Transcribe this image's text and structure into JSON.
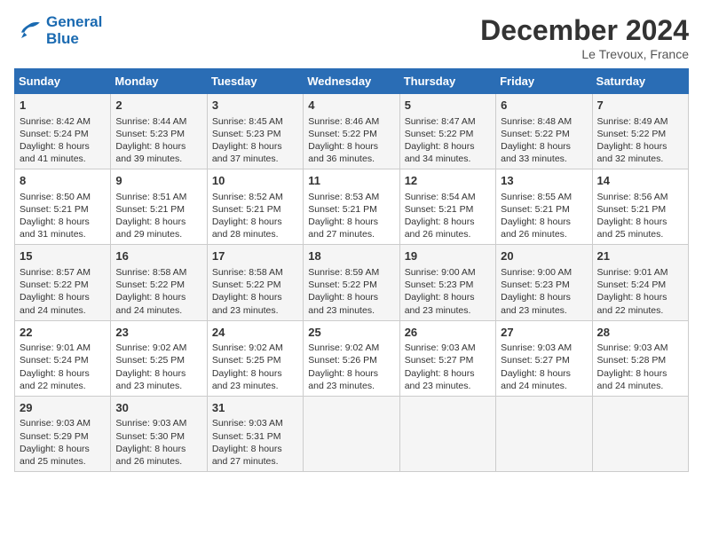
{
  "logo": {
    "line1": "General",
    "line2": "Blue"
  },
  "title": "December 2024",
  "location": "Le Trevoux, France",
  "days_of_week": [
    "Sunday",
    "Monday",
    "Tuesday",
    "Wednesday",
    "Thursday",
    "Friday",
    "Saturday"
  ],
  "weeks": [
    [
      {
        "num": "1",
        "sunrise": "8:42 AM",
        "sunset": "5:24 PM",
        "daylight": "8 hours and 41 minutes."
      },
      {
        "num": "2",
        "sunrise": "8:44 AM",
        "sunset": "5:23 PM",
        "daylight": "8 hours and 39 minutes."
      },
      {
        "num": "3",
        "sunrise": "8:45 AM",
        "sunset": "5:23 PM",
        "daylight": "8 hours and 37 minutes."
      },
      {
        "num": "4",
        "sunrise": "8:46 AM",
        "sunset": "5:22 PM",
        "daylight": "8 hours and 36 minutes."
      },
      {
        "num": "5",
        "sunrise": "8:47 AM",
        "sunset": "5:22 PM",
        "daylight": "8 hours and 34 minutes."
      },
      {
        "num": "6",
        "sunrise": "8:48 AM",
        "sunset": "5:22 PM",
        "daylight": "8 hours and 33 minutes."
      },
      {
        "num": "7",
        "sunrise": "8:49 AM",
        "sunset": "5:22 PM",
        "daylight": "8 hours and 32 minutes."
      }
    ],
    [
      {
        "num": "8",
        "sunrise": "8:50 AM",
        "sunset": "5:21 PM",
        "daylight": "8 hours and 31 minutes."
      },
      {
        "num": "9",
        "sunrise": "8:51 AM",
        "sunset": "5:21 PM",
        "daylight": "8 hours and 29 minutes."
      },
      {
        "num": "10",
        "sunrise": "8:52 AM",
        "sunset": "5:21 PM",
        "daylight": "8 hours and 28 minutes."
      },
      {
        "num": "11",
        "sunrise": "8:53 AM",
        "sunset": "5:21 PM",
        "daylight": "8 hours and 27 minutes."
      },
      {
        "num": "12",
        "sunrise": "8:54 AM",
        "sunset": "5:21 PM",
        "daylight": "8 hours and 26 minutes."
      },
      {
        "num": "13",
        "sunrise": "8:55 AM",
        "sunset": "5:21 PM",
        "daylight": "8 hours and 26 minutes."
      },
      {
        "num": "14",
        "sunrise": "8:56 AM",
        "sunset": "5:21 PM",
        "daylight": "8 hours and 25 minutes."
      }
    ],
    [
      {
        "num": "15",
        "sunrise": "8:57 AM",
        "sunset": "5:22 PM",
        "daylight": "8 hours and 24 minutes."
      },
      {
        "num": "16",
        "sunrise": "8:58 AM",
        "sunset": "5:22 PM",
        "daylight": "8 hours and 24 minutes."
      },
      {
        "num": "17",
        "sunrise": "8:58 AM",
        "sunset": "5:22 PM",
        "daylight": "8 hours and 23 minutes."
      },
      {
        "num": "18",
        "sunrise": "8:59 AM",
        "sunset": "5:22 PM",
        "daylight": "8 hours and 23 minutes."
      },
      {
        "num": "19",
        "sunrise": "9:00 AM",
        "sunset": "5:23 PM",
        "daylight": "8 hours and 23 minutes."
      },
      {
        "num": "20",
        "sunrise": "9:00 AM",
        "sunset": "5:23 PM",
        "daylight": "8 hours and 23 minutes."
      },
      {
        "num": "21",
        "sunrise": "9:01 AM",
        "sunset": "5:24 PM",
        "daylight": "8 hours and 22 minutes."
      }
    ],
    [
      {
        "num": "22",
        "sunrise": "9:01 AM",
        "sunset": "5:24 PM",
        "daylight": "8 hours and 22 minutes."
      },
      {
        "num": "23",
        "sunrise": "9:02 AM",
        "sunset": "5:25 PM",
        "daylight": "8 hours and 23 minutes."
      },
      {
        "num": "24",
        "sunrise": "9:02 AM",
        "sunset": "5:25 PM",
        "daylight": "8 hours and 23 minutes."
      },
      {
        "num": "25",
        "sunrise": "9:02 AM",
        "sunset": "5:26 PM",
        "daylight": "8 hours and 23 minutes."
      },
      {
        "num": "26",
        "sunrise": "9:03 AM",
        "sunset": "5:27 PM",
        "daylight": "8 hours and 23 minutes."
      },
      {
        "num": "27",
        "sunrise": "9:03 AM",
        "sunset": "5:27 PM",
        "daylight": "8 hours and 24 minutes."
      },
      {
        "num": "28",
        "sunrise": "9:03 AM",
        "sunset": "5:28 PM",
        "daylight": "8 hours and 24 minutes."
      }
    ],
    [
      {
        "num": "29",
        "sunrise": "9:03 AM",
        "sunset": "5:29 PM",
        "daylight": "8 hours and 25 minutes."
      },
      {
        "num": "30",
        "sunrise": "9:03 AM",
        "sunset": "5:30 PM",
        "daylight": "8 hours and 26 minutes."
      },
      {
        "num": "31",
        "sunrise": "9:03 AM",
        "sunset": "5:31 PM",
        "daylight": "8 hours and 27 minutes."
      },
      null,
      null,
      null,
      null
    ]
  ]
}
